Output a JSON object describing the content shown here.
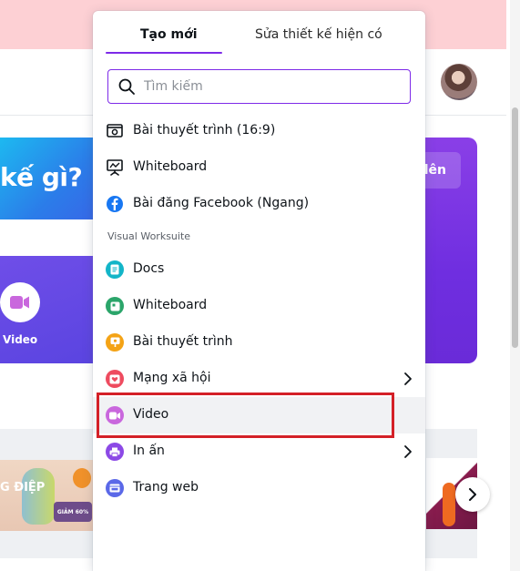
{
  "tabs": {
    "new": "Tạo mới",
    "edit_existing": "Sửa thiết kế hiện có"
  },
  "search": {
    "placeholder": "Tìm kiếm",
    "value": ""
  },
  "quick_items": [
    {
      "label": "Bài thuyết trình (16:9)",
      "icon": "presentation-icon"
    },
    {
      "label": "Whiteboard",
      "icon": "whiteboard-icon"
    },
    {
      "label": "Bài đăng Facebook (Ngang)",
      "icon": "facebook-icon"
    }
  ],
  "section_title": "Visual Worksuite",
  "suite_items": [
    {
      "label": "Docs",
      "icon": "docs-icon",
      "color": "#13b5c8"
    },
    {
      "label": "Whiteboard",
      "icon": "whiteboard-suite-icon",
      "color": "#2ba56a"
    },
    {
      "label": "Bài thuyết trình",
      "icon": "presentation-suite-icon",
      "color": "#f4a316"
    },
    {
      "label": "Mạng xã hội",
      "icon": "social-icon",
      "color": "#ee4b5f",
      "has_submenu": true
    },
    {
      "label": "Video",
      "icon": "video-icon",
      "color": "#c967dd",
      "highlighted": true
    },
    {
      "label": "In ấn",
      "icon": "print-icon",
      "color": "#8c49e6",
      "has_submenu": true
    },
    {
      "label": "Trang web",
      "icon": "website-icon",
      "color": "#5a68e8"
    }
  ],
  "background": {
    "hero_title": "kế gì?",
    "upload_label": "lên",
    "video_tile_label": "Video",
    "promo_text": "G ĐIỆP",
    "promo_badge": "GIẢM 60%"
  },
  "colors": {
    "accent": "#7d2ae8",
    "highlight_border": "#d42027",
    "banner": "#fdd0d4"
  }
}
